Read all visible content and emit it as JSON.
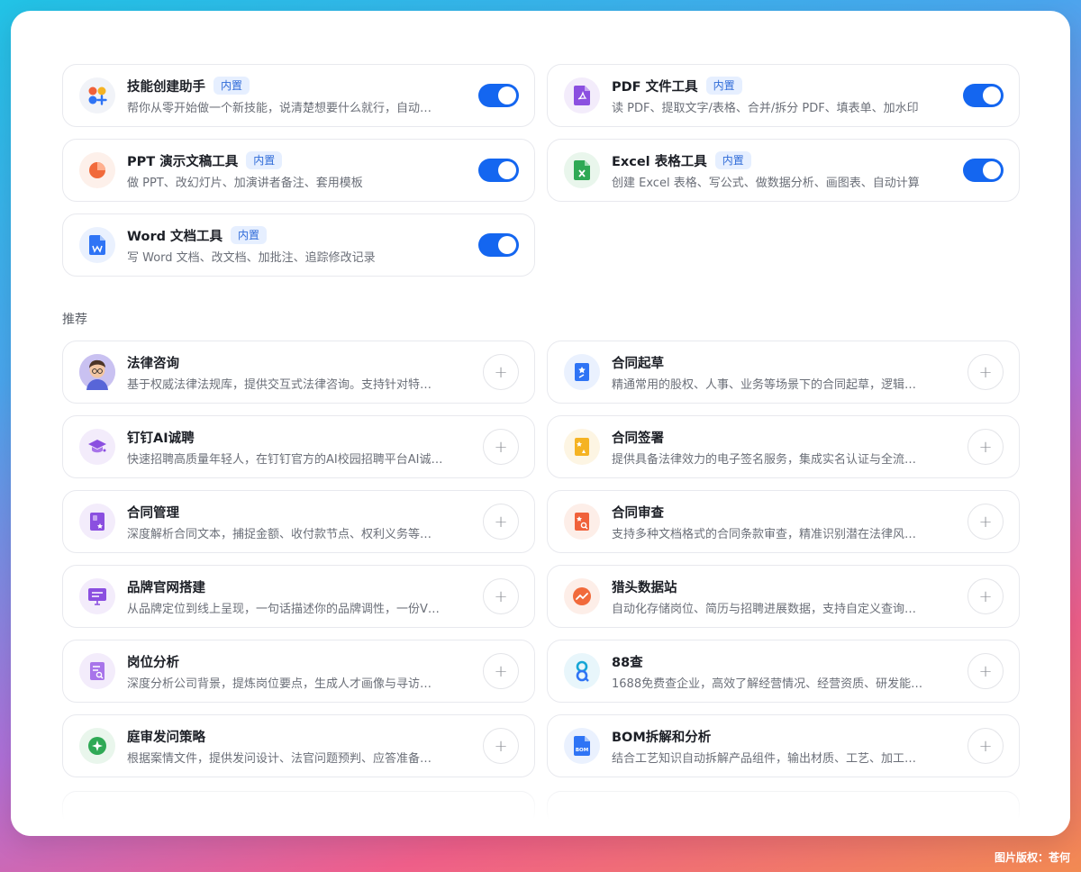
{
  "builtin_badge": "内置",
  "builtin": [
    {
      "title": "技能创建助手",
      "desc": "帮你从零开始做一个新技能，说清楚想要什么就行，自动…",
      "icon": "skill-creator-icon",
      "enabled": true
    },
    {
      "title": "PDF 文件工具",
      "desc": "读 PDF、提取文字/表格、合并/拆分 PDF、填表单、加水印",
      "icon": "pdf-icon",
      "enabled": true
    },
    {
      "title": "PPT 演示文稿工具",
      "desc": "做 PPT、改幻灯片、加演讲者备注、套用模板",
      "icon": "ppt-icon",
      "enabled": true
    },
    {
      "title": "Excel 表格工具",
      "desc": "创建 Excel 表格、写公式、做数据分析、画图表、自动计算",
      "icon": "excel-icon",
      "enabled": true
    },
    {
      "title": "Word 文档工具",
      "desc": "写 Word 文档、改文档、加批注、追踪修改记录",
      "icon": "word-icon",
      "enabled": true
    }
  ],
  "recommend_label": "推荐",
  "add_label": "+",
  "recommended": [
    {
      "title": "法律咨询",
      "desc": "基于权威法律法规库，提供交互式法律咨询。支持针对特…",
      "icon": "lawyer-avatar-icon"
    },
    {
      "title": "合同起草",
      "desc": "精通常用的股权、人事、业务等场景下的合同起草，逻辑…",
      "icon": "contract-draft-icon"
    },
    {
      "title": "钉钉AI诚聘",
      "desc": "快速招聘高质量年轻人，在钉钉官方的AI校园招聘平台AI诚…",
      "icon": "graduation-cap-icon"
    },
    {
      "title": "合同签署",
      "desc": "提供具备法律效力的电子签名服务，集成实名认证与全流…",
      "icon": "contract-sign-icon"
    },
    {
      "title": "合同管理",
      "desc": "深度解析合同文本，捕捉金额、收付款节点、权利义务等…",
      "icon": "contract-manage-icon"
    },
    {
      "title": "合同审查",
      "desc": "支持多种文档格式的合同条款审查，精准识别潜在法律风…",
      "icon": "contract-review-icon"
    },
    {
      "title": "品牌官网搭建",
      "desc": "从品牌定位到线上呈现，一句话描述你的品牌调性，一份V…",
      "icon": "website-builder-icon"
    },
    {
      "title": "猎头数据站",
      "desc": "自动化存储岗位、简历与招聘进展数据，支持自定义查询…",
      "icon": "trend-chart-icon"
    },
    {
      "title": "岗位分析",
      "desc": "深度分析公司背景，提炼岗位要点，生成人才画像与寻访…",
      "icon": "job-analysis-icon"
    },
    {
      "title": "88查",
      "desc": "1688免费查企业，高效了解经营情况、经营资质、研发能…",
      "icon": "88-search-icon"
    },
    {
      "title": "庭审发问策略",
      "desc": "根据案情文件，提供发问设计、法官问题预判、应答准备…",
      "icon": "court-strategy-icon"
    },
    {
      "title": "BOM拆解和分析",
      "desc": "结合工艺知识自动拆解产品组件，输出材质、工艺、加工…",
      "icon": "bom-icon"
    }
  ],
  "watermark": "图片版权：苍何"
}
